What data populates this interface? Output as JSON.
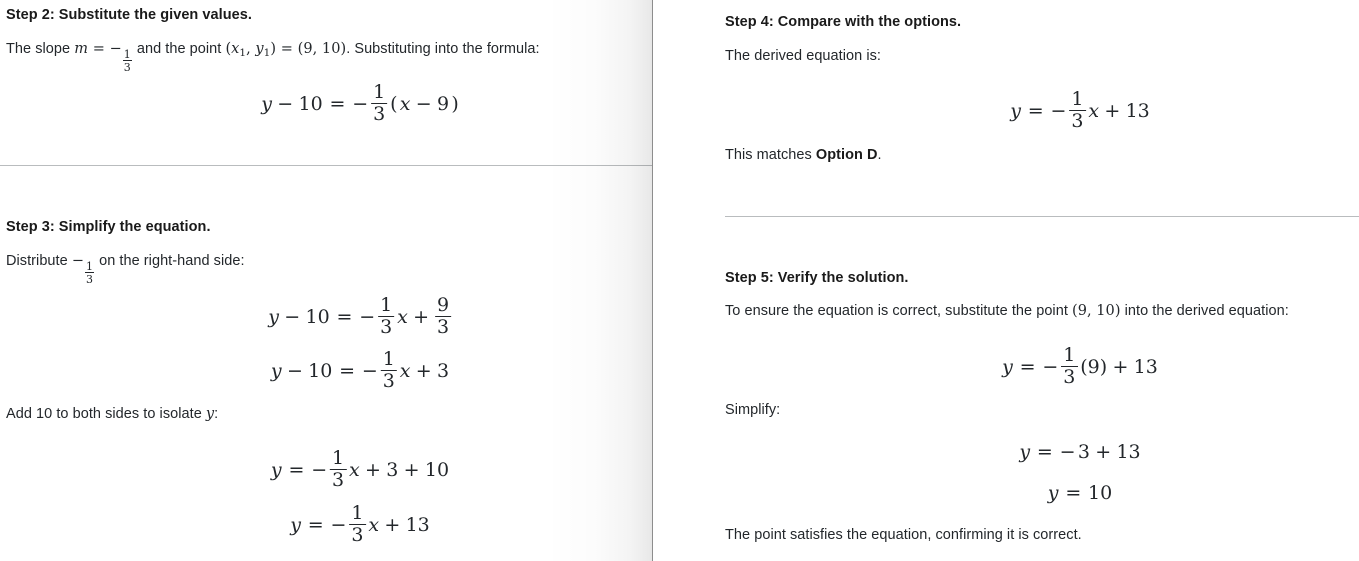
{
  "document": {
    "type": "math-solution-worksheet",
    "columns": 2,
    "colors": {
      "page_background": "#ffffff",
      "body_text": "#23272b",
      "heading_text": "#1a1a1a",
      "divider": "#b9bcbe",
      "page_edge": "#8d8d8d"
    }
  },
  "left_page": {
    "step2": {
      "heading": "Step 2: Substitute the given values.",
      "intro_part1": "The slope ",
      "intro_m": "m",
      "intro_eq1": " = ",
      "intro_minus": "−",
      "frac_num": "1",
      "frac_den": "3",
      "intro_part2": " and the point ",
      "point_x": "x",
      "point_x_sub": "1",
      "point_comma": ", ",
      "point_y": "y",
      "point_y_sub": "1",
      "intro_eq2": " = ",
      "point_value": "(9, 10)",
      "intro_part3": ". Substituting into the formula:",
      "equation": {
        "lhs_y": "y",
        "lhs_minus": "−",
        "lhs_10": "10",
        "rel": "=",
        "sign": "−",
        "num": "1",
        "den": "3",
        "group": "(x − 9)",
        "group_x": "x",
        "group_minus": "−",
        "group_9": "9"
      }
    },
    "step3": {
      "heading": "Step 3: Simplify the equation.",
      "distribute_part1": "Distribute ",
      "distribute_minus": "−",
      "distribute_num": "1",
      "distribute_den": "3",
      "distribute_part2": " on the right-hand side:",
      "equation1": {
        "y": "y",
        "minus": "−",
        "ten": "10",
        "rel": "=",
        "sign": "−",
        "num1": "1",
        "den1": "3",
        "x": "x",
        "plus": "+",
        "num2": "9",
        "den2": "3"
      },
      "equation2": {
        "y": "y",
        "minus": "−",
        "ten": "10",
        "rel": "=",
        "sign": "−",
        "num1": "1",
        "den1": "3",
        "x": "x",
        "plus": "+",
        "three": "3"
      },
      "add_part1": "Add 10 to both sides to isolate ",
      "add_y": "y",
      "add_part2": ":",
      "equation3": {
        "y": "y",
        "rel": "=",
        "sign": "−",
        "num1": "1",
        "den1": "3",
        "x": "x",
        "plus1": "+",
        "three": "3",
        "plus2": "+",
        "ten": "10"
      },
      "equation4": {
        "y": "y",
        "rel": "=",
        "sign": "−",
        "num1": "1",
        "den1": "3",
        "x": "x",
        "plus": "+",
        "thirteen": "13"
      }
    }
  },
  "right_page": {
    "step4": {
      "heading": "Step 4: Compare with the options.",
      "intro": "The derived equation is:",
      "equation": {
        "y": "y",
        "rel": "=",
        "sign": "−",
        "num1": "1",
        "den1": "3",
        "x": "x",
        "plus": "+",
        "thirteen": "13"
      },
      "match_prefix": "This matches ",
      "match_option": "Option D",
      "match_suffix": "."
    },
    "step5": {
      "heading": "Step 5: Verify the solution.",
      "intro_part1": "To ensure the equation is correct, substitute the point ",
      "intro_point": "(9, 10)",
      "intro_part2": " into the derived equation:",
      "equation1": {
        "y": "y",
        "rel": "=",
        "sign": "−",
        "num1": "1",
        "den1": "3",
        "group": "(9)",
        "plus": "+",
        "thirteen": "13"
      },
      "simplify_label": "Simplify:",
      "equation2": {
        "y": "y",
        "rel": "=",
        "minus": "−",
        "three": "3",
        "plus": "+",
        "thirteen": "13"
      },
      "equation3": {
        "y": "y",
        "rel": "=",
        "ten": "10"
      },
      "conclusion": "The point satisfies the equation, confirming it is correct."
    }
  }
}
